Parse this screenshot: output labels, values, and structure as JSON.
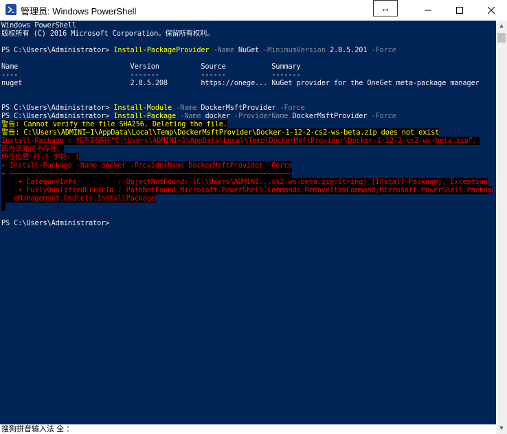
{
  "window": {
    "title": "管理员: Windows PowerShell",
    "resize_glyph": "↔",
    "minimize_glyph": "—",
    "maximize_glyph": "☐",
    "close_glyph": "✕"
  },
  "console": {
    "bg_color": "#012456",
    "lines": [
      {
        "segments": [
          {
            "text": "Windows PowerShell",
            "style": "white"
          }
        ]
      },
      {
        "segments": [
          {
            "text": "版权所有 (C) 2016 Microsoft Corporation。保留所有权利。",
            "style": "white"
          }
        ]
      },
      {
        "segments": []
      },
      {
        "segments": [
          {
            "text": "PS C:\\Users\\Administrator> ",
            "style": "white"
          },
          {
            "text": "Install-PackageProvider",
            "style": "yellow"
          },
          {
            "text": " -Name ",
            "style": "gray"
          },
          {
            "text": "NuGet",
            "style": "white"
          },
          {
            "text": " -MinimumVersion ",
            "style": "gray"
          },
          {
            "text": "2.8.5.201",
            "style": "white"
          },
          {
            "text": " -Force",
            "style": "gray"
          }
        ]
      },
      {
        "segments": []
      },
      {
        "segments": [
          {
            "text": "Name                           Version          Source           Summary",
            "style": "white"
          }
        ]
      },
      {
        "segments": [
          {
            "text": "----                           -------          ------           -------",
            "style": "white"
          }
        ]
      },
      {
        "segments": [
          {
            "text": "nuget                          2.8.5.208        https://onege... NuGet provider for the OneGet meta-package manager",
            "style": "white"
          }
        ]
      },
      {
        "segments": []
      },
      {
        "segments": []
      },
      {
        "segments": [
          {
            "text": "PS C:\\Users\\Administrator> ",
            "style": "white"
          },
          {
            "text": "Install-Module",
            "style": "yellow"
          },
          {
            "text": " -Name ",
            "style": "gray"
          },
          {
            "text": "DockerMsftProvider",
            "style": "white"
          },
          {
            "text": " -Force",
            "style": "gray"
          }
        ]
      },
      {
        "segments": [
          {
            "text": "PS C:\\Users\\Administrator> ",
            "style": "white"
          },
          {
            "text": "Install-Package",
            "style": "yellow"
          },
          {
            "text": " -Name ",
            "style": "gray"
          },
          {
            "text": "docker",
            "style": "white"
          },
          {
            "text": " -ProviderName ",
            "style": "gray"
          },
          {
            "text": "DockerMsftProvider",
            "style": "white"
          },
          {
            "text": " -Force",
            "style": "gray"
          }
        ]
      },
      {
        "segments": [
          {
            "text": "警告: Cannot verify the file SHA256. Deleting the file.",
            "style": "warn"
          }
        ]
      },
      {
        "segments": [
          {
            "text": "警告: C:\\Users\\ADMINI~1\\AppData\\Local\\Temp\\DockerMsftProvider\\Docker-1-12-2-cs2-ws-beta.zip does not exist",
            "style": "warn"
          }
        ]
      },
      {
        "segments": [
          {
            "text": "Install-Package : 找不到路径“C:\\Users\\ADMINI~1\\AppData\\Local\\Temp\\DockerMsftProvider\\Docker-1-12-2-cs2-ws-beta.zip”，",
            "style": "err"
          }
        ]
      },
      {
        "segments": [
          {
            "text": "因为该路径不存在。",
            "style": "err"
          }
        ]
      },
      {
        "segments": [
          {
            "text": "所在位置 行:1 字符: 1",
            "style": "err"
          }
        ]
      },
      {
        "segments": [
          {
            "text": "+ Install-Package -Name docker -ProviderName DockerMsftProvider -Force",
            "style": "err"
          }
        ]
      },
      {
        "segments": [
          {
            "text": "+ ~~~~~~~~~~~~~~~~~~~~~~~~~~~~~~~~~~~~~~~~~~~~~~~~~~~~~~~~~~~~~~~~~~~~",
            "style": "err"
          }
        ]
      },
      {
        "segments": [
          {
            "text": "    + CategoryInfo          : ObjectNotFound: (C:\\Users\\ADMINI...cs2-ws-beta.zip:String) [Install-Package], Exception",
            "style": "err"
          }
        ]
      },
      {
        "segments": [
          {
            "text": "    + FullyQualifiedErrorId : PathNotFound,Microsoft.PowerShell.Commands.RemoveItemCommand,Microsoft.PowerShell.Packag",
            "style": "err"
          }
        ]
      },
      {
        "segments": [
          {
            "text": "   eManagement.Cmdlets.InstallPackage",
            "style": "err"
          }
        ]
      },
      {
        "segments": [
          {
            "text": " ",
            "style": "err"
          }
        ]
      },
      {
        "segments": []
      },
      {
        "segments": [
          {
            "text": "PS C:\\Users\\Administrator>",
            "style": "white"
          }
        ]
      }
    ],
    "ime_status": "搜狗拼音输入法 全 ："
  },
  "scrollbar": {
    "up_glyph": "▲",
    "down_glyph": "▼"
  }
}
